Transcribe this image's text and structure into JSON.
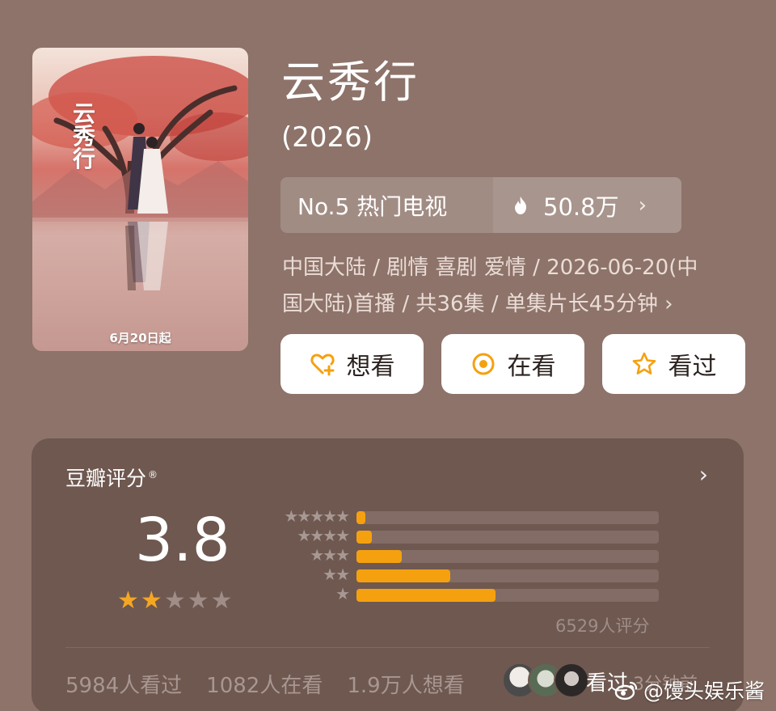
{
  "poster": {
    "calligraphy": "云秀行",
    "date_badge": "6月20日起"
  },
  "show": {
    "title": "云秀行",
    "year": "(2026)"
  },
  "rank": {
    "label": "No.5 热门电视",
    "heat": "50.8万",
    "chevron": "›"
  },
  "meta": {
    "line1": "中国大陆 / 剧情 喜剧 爱情 / 2026-06-20(中",
    "line2": "国大陆)首播 / 共36集 / 单集片长45分钟 ›"
  },
  "actions": [
    {
      "label": "想看",
      "icon": "heart-plus-icon"
    },
    {
      "label": "在看",
      "icon": "target-icon"
    },
    {
      "label": "看过",
      "icon": "star-outline-icon"
    }
  ],
  "rating": {
    "title": "豆瓣评分",
    "registered": "®",
    "chevron": "›",
    "score": "3.8",
    "stars_filled": 2,
    "stars_total": 5,
    "distribution": [
      {
        "stars": "★★★★★",
        "percent": 3
      },
      {
        "stars": "★★★★",
        "percent": 5
      },
      {
        "stars": "★★★",
        "percent": 15
      },
      {
        "stars": "★★",
        "percent": 31
      },
      {
        "stars": "★",
        "percent": 46
      }
    ],
    "total": "6529人评分"
  },
  "stats": {
    "watched": "5984人看过",
    "watching": "1082人在看",
    "want": "1.9万人想看",
    "recent_action": "看过",
    "recent_time": "3分钟前"
  },
  "watermark": "@馒头娱乐酱",
  "colors": {
    "background": "#8d7369",
    "card": "#6e5850",
    "accent": "#f5a10f",
    "star": "#f5a623"
  }
}
